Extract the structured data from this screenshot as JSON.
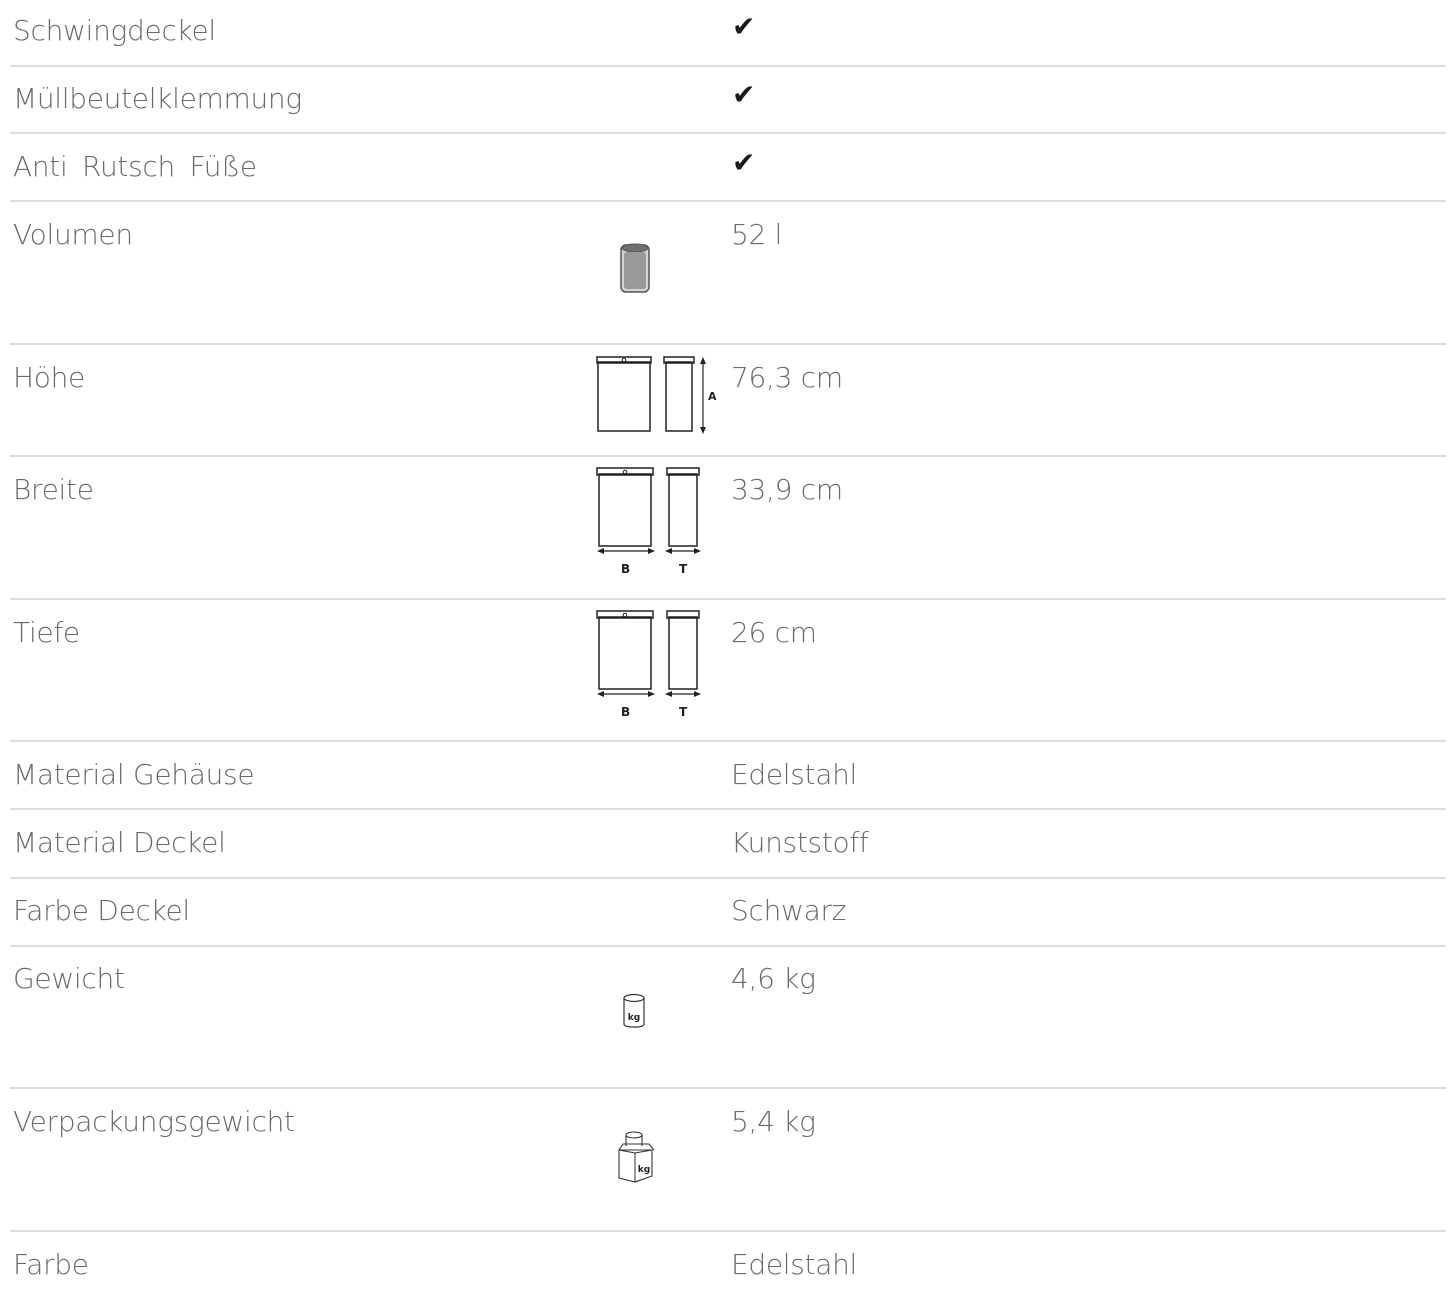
{
  "rows": [
    {
      "label": "Schwingdeckel",
      "value": "✔"
    },
    {
      "label": "Müllbeutelklemmung",
      "value": "✔"
    },
    {
      "label": "Anti  Rutsch  Füße",
      "value": "✔"
    },
    {
      "label": "Volumen",
      "value": "52 l",
      "icon": "bin-volume-icon"
    },
    {
      "label": "Höhe",
      "value": "76,3 cm",
      "icon": "height-dimension-icon",
      "icon_labels": [
        "A"
      ]
    },
    {
      "label": "Breite",
      "value": "33,9 cm",
      "icon": "width-depth-dimension-icon",
      "icon_labels": [
        "B",
        "T"
      ]
    },
    {
      "label": "Tiefe",
      "value": "26 cm",
      "icon": "width-depth-dimension-icon",
      "icon_labels": [
        "B",
        "T"
      ]
    },
    {
      "label": "Material Gehäuse",
      "value": "Edelstahl"
    },
    {
      "label": "Material Deckel",
      "value": "Kunststoff"
    },
    {
      "label": "Farbe Deckel",
      "value": "Schwarz"
    },
    {
      "label": "Gewicht",
      "value": "4,6 kg",
      "icon": "weight-icon",
      "icon_labels": [
        "kg"
      ]
    },
    {
      "label": "Verpackungsgewicht",
      "value": "5,4 kg",
      "icon": "package-weight-icon",
      "icon_labels": [
        "kg"
      ]
    },
    {
      "label": "Farbe",
      "value": "Edelstahl"
    }
  ],
  "colors": {
    "text": "#6a6a6a",
    "check": "#1a1a1a",
    "separator": "#dddddd"
  }
}
